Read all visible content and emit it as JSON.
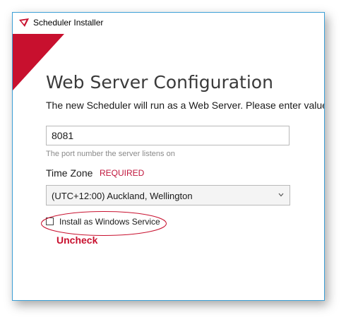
{
  "window": {
    "title": "Scheduler Installer"
  },
  "colors": {
    "accent_red": "#c8102e",
    "frame_blue": "#3c9fd6"
  },
  "icons": {
    "app": "scheduler-logo-icon",
    "dropdown": "chevron-down-icon"
  },
  "page": {
    "heading": "Web Server Configuration",
    "subtitle": "The new Scheduler will run as a Web Server. Please enter values"
  },
  "port": {
    "value": "8081",
    "hint": "The port number the server listens on"
  },
  "timezone": {
    "label": "Time Zone",
    "required": "REQUIRED",
    "selected": "(UTC+12:00) Auckland, Wellington"
  },
  "service": {
    "label": "Install as Windows Service",
    "checked": false
  },
  "annotation": {
    "text": "Uncheck"
  }
}
